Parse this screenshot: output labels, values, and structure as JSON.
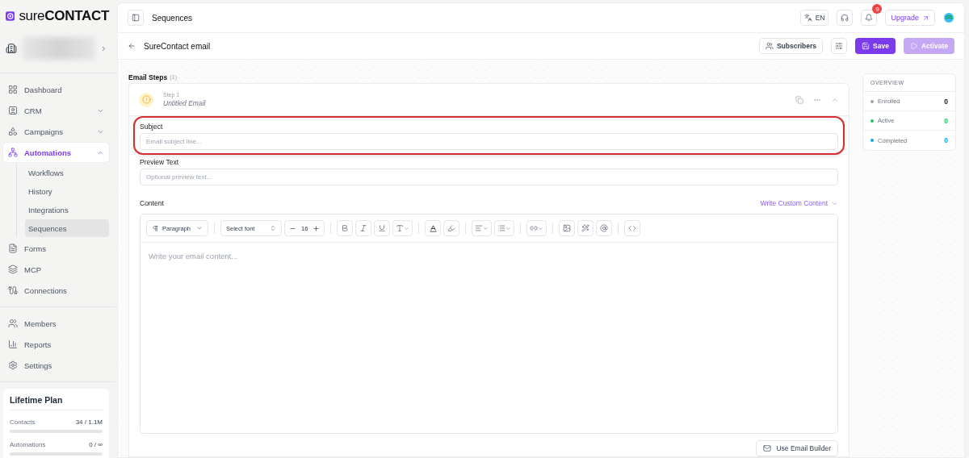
{
  "sidebar": {
    "logo": "sure**CONTACT**",
    "sections": [
      [
        {
          "label": "Dashboard",
          "selected": false
        },
        {
          "label": "CRM",
          "selected": false,
          "expanded": false
        },
        {
          "label": "Campaigns",
          "selected": false,
          "expanded": false
        },
        {
          "label": "Automations",
          "selected": true,
          "expanded": true,
          "children": [
            {
              "label": "Workflows",
              "selected": false
            },
            {
              "label": "History",
              "selected": false
            },
            {
              "label": "Integrations",
              "selected": false
            },
            {
              "label": "Sequences",
              "selected": true
            }
          ]
        },
        {
          "label": "Forms",
          "selected": false
        },
        {
          "label": "MCP",
          "selected": false
        },
        {
          "label": "Connections",
          "selected": false
        }
      ],
      [
        {
          "label": "Members",
          "selected": false
        },
        {
          "label": "Reports",
          "selected": false
        },
        {
          "label": "Settings",
          "selected": false
        }
      ]
    ],
    "plan": {
      "title": "Lifetime Plan",
      "rows": [
        {
          "label": "Contacts",
          "value": "34 / 1.1M",
          "level": 0
        },
        {
          "label": "Automations",
          "value": "0 / ∞",
          "level": 0
        }
      ]
    }
  },
  "header": {
    "title": "Sequences",
    "language": "EN",
    "notification_count": "9",
    "upgrade": "Upgrade"
  },
  "subheader": {
    "title": "SureContact email",
    "buttons": [
      {
        "kind": "subscribers",
        "label": "Subscribers"
      },
      {
        "kind": "save",
        "label": "Save"
      },
      {
        "kind": "activate",
        "label": "Activate",
        "disabled": true
      }
    ]
  },
  "steps": {
    "title": "Email Steps",
    "count": "(1)",
    "items": [
      {
        "label": "Step 1",
        "name": "Untitled Email",
        "expanded": true,
        "fields": [
          {
            "label": "Subject",
            "placeholder": "Email subject line...",
            "highlighted": true
          },
          {
            "label": "Preview Text",
            "placeholder": "Optional preview text...",
            "highlighted": false
          }
        ],
        "content": {
          "label": "Content",
          "link": "Write Custom Content",
          "block": "Paragraph",
          "font": "Select font",
          "size": "16",
          "placeholder": "Write your email content...",
          "builder_button": "Use Email Builder"
        }
      }
    ]
  },
  "overview": {
    "title": "OVERVIEW",
    "stats": [
      {
        "label": "Enrolled",
        "value": "0",
        "color": "#9ca3af"
      },
      {
        "label": "Active",
        "value": "0",
        "color": "#22c55e"
      },
      {
        "label": "Completed",
        "value": "0",
        "color": "#0ea5e9"
      }
    ]
  }
}
